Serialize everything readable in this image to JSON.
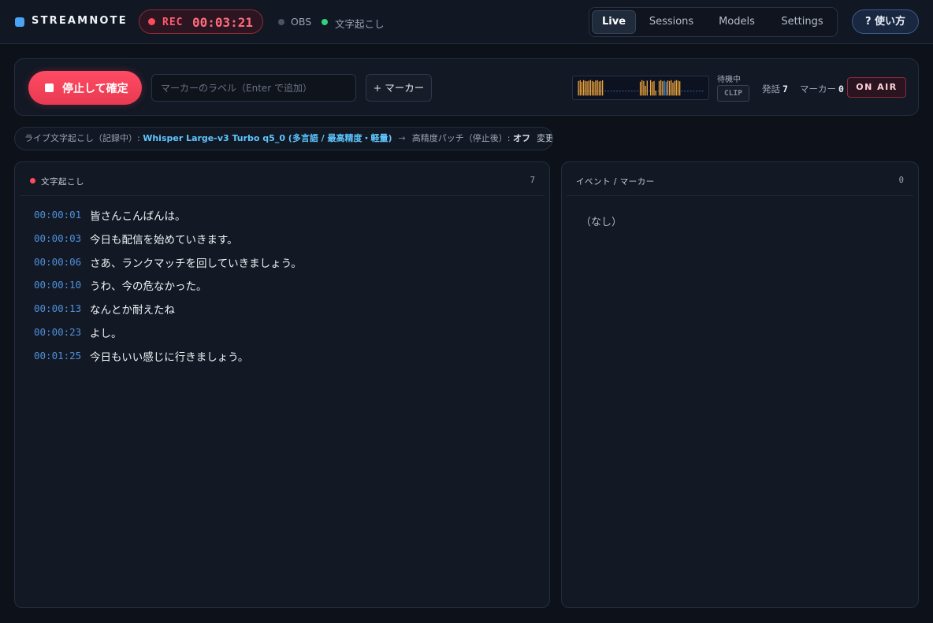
{
  "header": {
    "brand": "STREAMNOTE",
    "rec_label": "REC",
    "rec_time": "00:03:21",
    "obs_label": "OBS",
    "transcribe_label": "文字起こし",
    "tabs": [
      {
        "label": "Live",
        "active": true
      },
      {
        "label": "Sessions",
        "active": false
      },
      {
        "label": "Models",
        "active": false
      },
      {
        "label": "Settings",
        "active": false
      }
    ],
    "help_label": "? 使い方"
  },
  "controls": {
    "stop_label": "停止して確定",
    "marker_placeholder": "マーカーのラベル（Enter で追加）",
    "add_marker_label": "+ マーカー",
    "waiting_label": "待機中",
    "clip_label": "CLIP",
    "utterances_label": "発話",
    "utterances_count": "7",
    "markers_label": "マーカー",
    "markers_count": "0",
    "onair_label": "ON AIR",
    "levels": [
      0.9,
      0.95,
      0.85,
      0.95,
      0.9,
      0.88,
      0.92,
      0.96,
      0.9,
      0.85,
      0.93,
      0.95,
      0.87,
      0.9,
      0.94,
      0,
      0,
      0,
      0,
      0,
      0,
      0,
      0,
      0,
      0,
      0,
      0,
      0,
      0,
      0,
      0,
      0,
      0,
      0,
      0,
      0,
      0.85,
      0.95,
      0.9,
      0.6,
      0.92,
      0,
      0.95,
      0.85,
      0.9,
      0.3,
      0,
      0.9,
      0.95,
      0.88,
      0.92,
      0.85,
      0.93,
      0.9,
      0.95,
      0.8,
      0.9,
      0.95,
      0.92,
      0.88,
      0,
      0,
      0,
      0,
      0,
      0,
      0,
      0,
      0,
      0,
      0,
      0,
      0
    ],
    "colors": {
      "bar": "#f0a63a",
      "bar_blue": "#4c8ee0",
      "baseline": "#3d6fb0"
    }
  },
  "model_info": {
    "prefix": "ライブ文字起こし（記録中）: ",
    "model": "Whisper Large-v3 Turbo q5_0 (多言語 / 最高精度・軽量)",
    "arrow": "→",
    "hp_label": "高精度パッチ（停止後）: ",
    "hp_value": "オフ",
    "change_label": "変更 ›"
  },
  "transcript": {
    "title": "文字起こし",
    "count": "7",
    "rows": [
      {
        "time": "00:00:01",
        "text": "皆さんこんばんは。"
      },
      {
        "time": "00:00:03",
        "text": "今日も配信を始めていきます。"
      },
      {
        "time": "00:00:06",
        "text": "さあ、ランクマッチを回していきましょう。"
      },
      {
        "time": "00:00:10",
        "text": "うわ、今の危なかった。"
      },
      {
        "time": "00:00:13",
        "text": "なんとか耐えたね"
      },
      {
        "time": "00:00:23",
        "text": "よし。"
      },
      {
        "time": "00:01:25",
        "text": "今日もいい感じに行きましょう。"
      }
    ]
  },
  "events": {
    "title": "イベント / マーカー",
    "count": "0",
    "empty": "（なし）"
  }
}
